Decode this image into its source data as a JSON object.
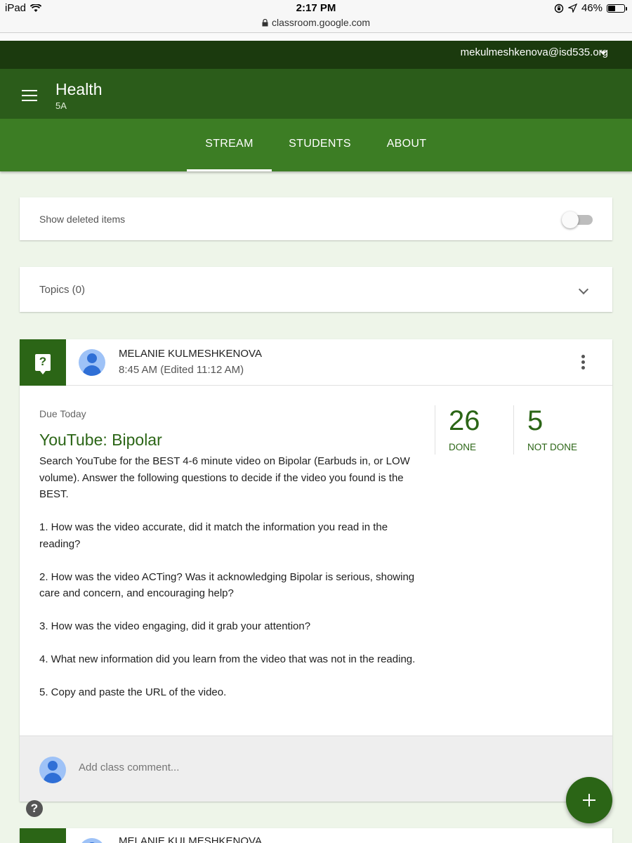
{
  "status_bar": {
    "device": "iPad",
    "time": "2:17 PM",
    "battery": "46%",
    "battery_level": 0.46
  },
  "browser": {
    "url": "classroom.google.com"
  },
  "account": {
    "email": "mekulmeshkenova@isd535.org"
  },
  "header": {
    "title": "Health",
    "section": "5A"
  },
  "tabs": [
    {
      "label": "STREAM",
      "active": true
    },
    {
      "label": "STUDENTS",
      "active": false
    },
    {
      "label": "ABOUT",
      "active": false
    }
  ],
  "settings": {
    "show_deleted_label": "Show deleted items",
    "show_deleted_on": false
  },
  "topics": {
    "label": "Topics (0)"
  },
  "post": {
    "author": "MELANIE KULMESHKENOVA",
    "timestamp": "8:45 AM (Edited 11:12 AM)",
    "due": "Due Today",
    "title": "YouTube: Bipolar",
    "description": [
      "Search YouTube for the BEST 4-6 minute video on Bipolar (Earbuds in, or LOW volume). Answer the following questions to decide if the video you found is the BEST.",
      "1. How was the video accurate, did it match the information you read in the reading?",
      "2. How was the video ACTing? Was it acknowledging Bipolar is serious, showing care and concern, and encouraging help?",
      "3. How was the video engaging, did it grab your attention?",
      "4. What new information did you learn from the video that was not in the reading.",
      "5. Copy and paste the URL of the video."
    ],
    "stats": {
      "done_count": "26",
      "done_label": "DONE",
      "not_done_count": "5",
      "not_done_label": "NOT DONE"
    },
    "comment_placeholder": "Add class comment..."
  },
  "next_post": {
    "author": "MELANIE KULMESHKENOVA"
  },
  "colors": {
    "account_bar": "#1b3a0e",
    "header": "#2b5c1a",
    "tabs": "#3c7d24",
    "accent": "#2b6516",
    "background": "#eef5e9"
  }
}
